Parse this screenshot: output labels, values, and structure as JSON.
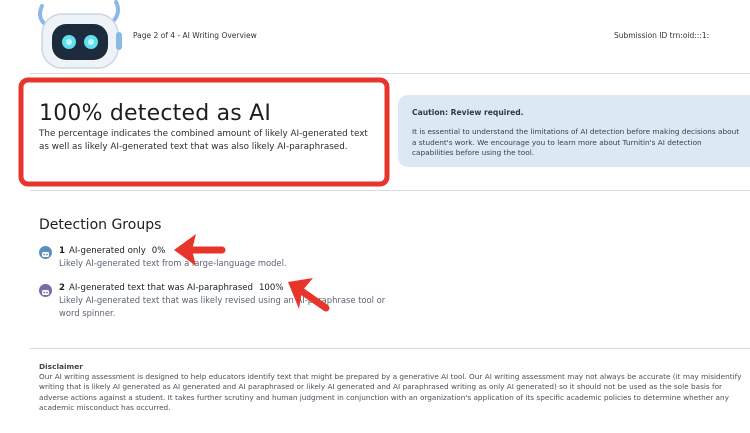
{
  "header": {
    "page_info": "Page 2 of 4 - AI Writing Overview",
    "submission_id": "Submission ID trn:oid:::1:"
  },
  "summary": {
    "title": "100% detected as AI",
    "description": "The percentage indicates the combined amount of likely AI-generated text as well as likely AI-generated text that was also likely AI-paraphrased."
  },
  "caution": {
    "title": "Caution: Review required.",
    "body": "It is essential to understand the limitations of AI detection before making decisions about a student's work. We encourage you to learn more about Turnitin's AI detection capabilities before using the tool."
  },
  "detection_groups": {
    "title": "Detection Groups",
    "groups": [
      {
        "number": "1",
        "label": "AI-generated only",
        "percent": "0%",
        "description": "Likely AI-generated text from a large-language model.",
        "icon": "robot-icon",
        "color": "#5a8fc0"
      },
      {
        "number": "2",
        "label": "AI-generated text that was AI-paraphrased",
        "percent": "100%",
        "description": "Likely AI-generated text that was likely revised using an AI-paraphrase tool or word spinner.",
        "icon": "paraphrase-robot-icon",
        "color": "#7b6ba8"
      }
    ]
  },
  "disclaimer": {
    "title": "Disclaimer",
    "body": "Our AI writing assessment is designed to help educators identify text that might be prepared by a generative AI tool. Our AI writing assessment may not always be accurate (it may misidentify writing that is likely AI generated as AI generated and AI paraphrased or likely AI generated and AI paraphrased writing as only AI generated) so it should not be used as the sole basis for adverse actions against a student. It takes further scrutiny and human judgment in conjunction with an organization's application of its specific academic policies to determine whether any academic misconduct has occurred."
  },
  "annotation_colors": {
    "highlight_box": "#e8352b",
    "arrows": "#e8352b"
  }
}
